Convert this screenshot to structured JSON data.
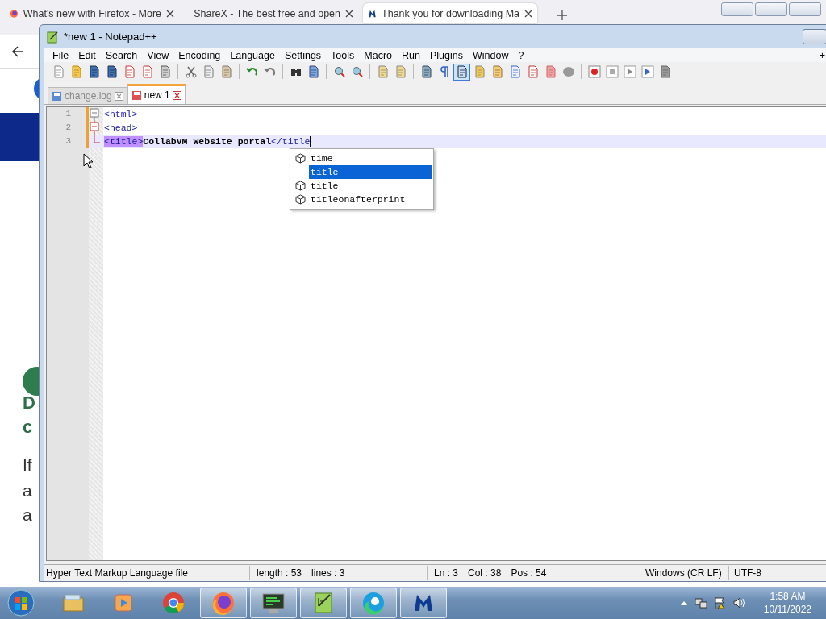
{
  "browser": {
    "tabs": [
      {
        "title": "What's new with Firefox - More",
        "selected": false
      },
      {
        "title": "ShareX - The best free and open",
        "selected": false
      },
      {
        "title": "Thank you for downloading Ma",
        "selected": true
      }
    ],
    "page_fragments": [
      "D",
      "c",
      "If",
      "a",
      "a"
    ]
  },
  "notepad": {
    "title": "*new 1 - Notepad++",
    "menu": [
      "File",
      "Edit",
      "Search",
      "View",
      "Encoding",
      "Language",
      "Settings",
      "Tools",
      "Macro",
      "Run",
      "Plugins",
      "Window",
      "?"
    ],
    "menu_extra": "+",
    "tabs": [
      {
        "label": "change.log",
        "selected": false
      },
      {
        "label": "new 1",
        "selected": true
      }
    ],
    "lines": [
      {
        "number": "1",
        "kind": "open",
        "current": false,
        "segments": [
          {
            "kind": "tag",
            "text": "<html>"
          }
        ]
      },
      {
        "number": "2",
        "kind": "open-active",
        "current": false,
        "segments": [
          {
            "kind": "tag",
            "text": "<head>"
          }
        ]
      },
      {
        "number": "3",
        "kind": "end",
        "current": true,
        "segments": [
          {
            "kind": "tag-match",
            "text": "<title>"
          },
          {
            "kind": "text",
            "text": "CollabVM Website portal"
          },
          {
            "kind": "tag",
            "text": "</title"
          }
        ]
      }
    ],
    "autocomplete": [
      {
        "label": "time",
        "icon": true,
        "selected": false
      },
      {
        "label": "title",
        "icon": false,
        "selected": true
      },
      {
        "label": "title",
        "icon": true,
        "selected": false
      },
      {
        "label": "titleonafterprint",
        "icon": true,
        "selected": false
      }
    ],
    "status_bar": {
      "file_type": "Hyper Text Markup Language file",
      "length": "length : 53",
      "lines": "lines : 3",
      "line": "Ln : 3",
      "column": "Col : 38",
      "position": "Pos : 54",
      "eol": "Windows (CR LF)",
      "encoding": "UTF-8"
    }
  },
  "taskbar": {
    "apps": [
      {
        "kind": "explorer",
        "open": false
      },
      {
        "kind": "media",
        "open": false
      },
      {
        "kind": "chrome",
        "open": false
      },
      {
        "kind": "firefox",
        "open": true
      },
      {
        "kind": "terminal",
        "open": true
      },
      {
        "kind": "notepad",
        "open": true
      },
      {
        "kind": "edge",
        "open": true
      },
      {
        "kind": "malwarebytes",
        "open": true
      }
    ],
    "time": "1:58 AM",
    "date": "10/11/2022"
  }
}
